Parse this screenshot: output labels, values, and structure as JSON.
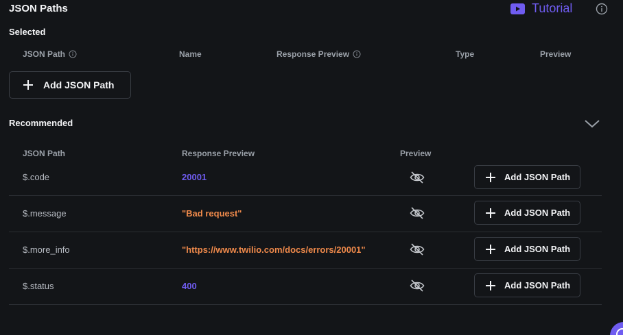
{
  "header": {
    "title": "JSON Paths",
    "tutorial_label": "Tutorial",
    "tutorial_icon": "youtube-icon",
    "info_icon": "info-icon"
  },
  "selected": {
    "label": "Selected",
    "columns": {
      "json_path": "JSON Path",
      "name": "Name",
      "response_preview": "Response Preview",
      "type": "Type",
      "preview": "Preview"
    },
    "add_button_label": "Add JSON Path"
  },
  "recommended": {
    "label": "Recommended",
    "collapse_icon": "chevron-down-icon",
    "columns": {
      "json_path": "JSON Path",
      "response_preview": "Response Preview",
      "preview": "Preview"
    },
    "rows": [
      {
        "path": "$.code",
        "value": "20001",
        "value_kind": "number",
        "action_label": "Add JSON Path"
      },
      {
        "path": "$.message",
        "value": "\"Bad request\"",
        "value_kind": "string",
        "action_label": "Add JSON Path"
      },
      {
        "path": "$.more_info",
        "value": "\"https://www.twilio.com/docs/errors/20001\"",
        "value_kind": "string",
        "action_label": "Add JSON Path"
      },
      {
        "path": "$.status",
        "value": "400",
        "value_kind": "number",
        "action_label": "Add JSON Path"
      }
    ]
  },
  "colors": {
    "accent": "#6f5cf0",
    "string_value": "#f08a4b",
    "background": "#131518"
  }
}
